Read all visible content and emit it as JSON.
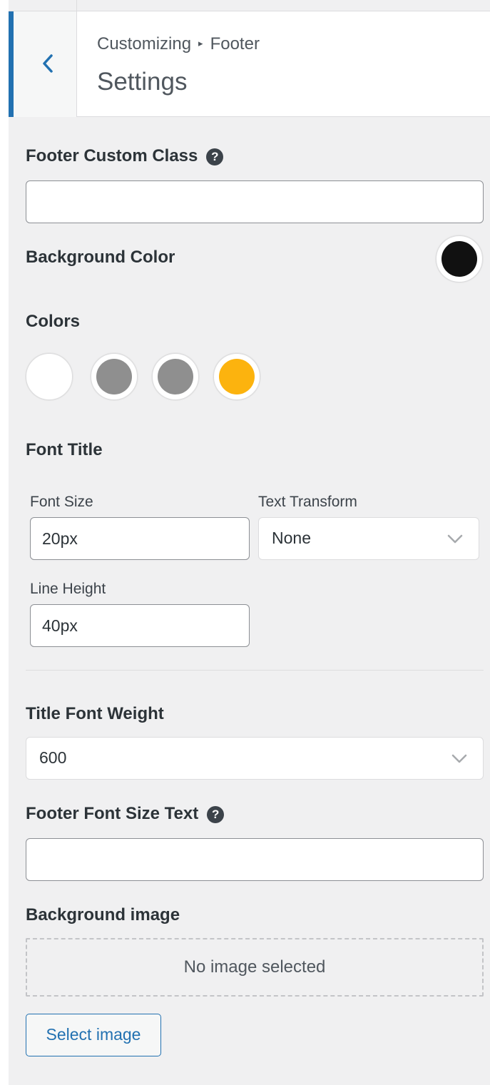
{
  "header": {
    "breadcrumb_parent": "Customizing",
    "breadcrumb_arrow": "▸",
    "breadcrumb_current": "Footer",
    "title": "Settings"
  },
  "fields": {
    "footer_custom_class": {
      "label": "Footer Custom Class",
      "help": "?",
      "value": ""
    },
    "background_color": {
      "label": "Background Color",
      "color": "#111111"
    },
    "colors": {
      "label": "Colors",
      "swatches": [
        "#ffffff",
        "#8f8f8f",
        "#8f8f8f",
        "#fcb30e"
      ]
    },
    "font_title": {
      "label": "Font Title",
      "font_size": {
        "label": "Font Size",
        "value": "20px"
      },
      "text_transform": {
        "label": "Text Transform",
        "value": "None"
      },
      "line_height": {
        "label": "Line Height",
        "value": "40px"
      }
    },
    "title_font_weight": {
      "label": "Title Font Weight",
      "value": "600"
    },
    "footer_font_size_text": {
      "label": "Footer Font Size Text",
      "help": "?",
      "value": ""
    },
    "background_image": {
      "label": "Background image",
      "placeholder": "No image selected",
      "button": "Select image"
    }
  },
  "theme": {
    "accent": "#2271b1",
    "panel_bg": "#f0f0f1",
    "border": "#8c8f94"
  }
}
